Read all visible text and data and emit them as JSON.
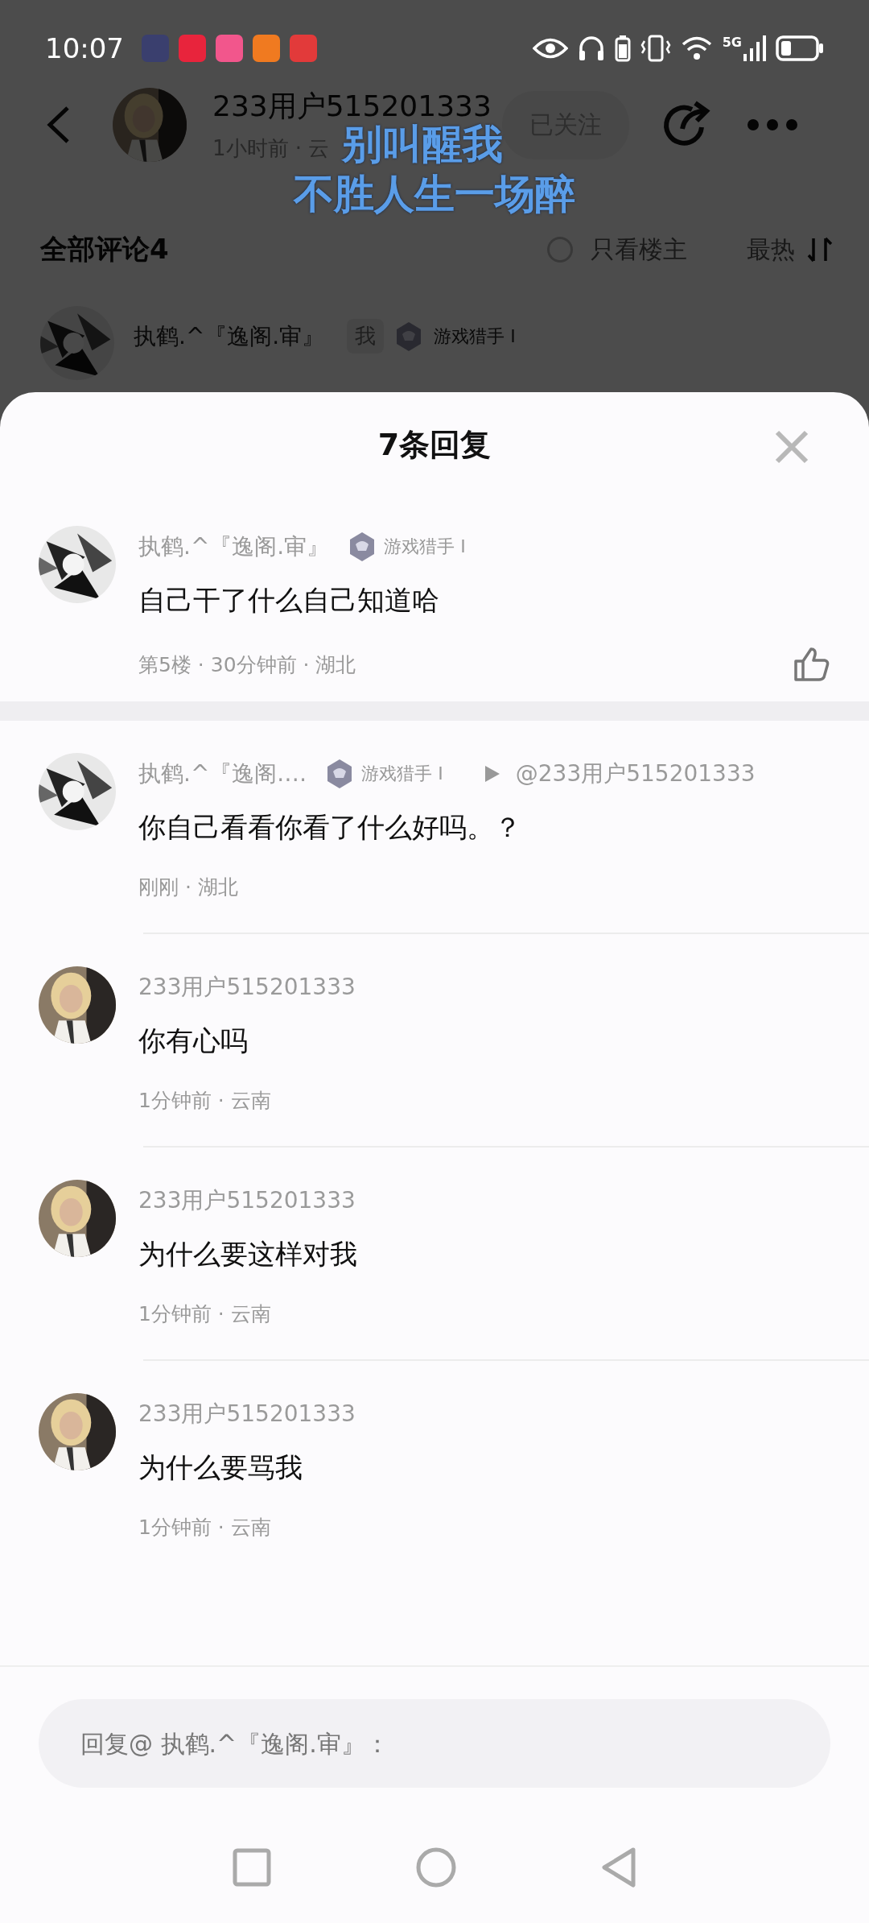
{
  "status_bar": {
    "time": "10:07",
    "notifications": [
      {
        "color": "#3a3f6e"
      },
      {
        "color": "#e8243c"
      },
      {
        "color": "#f2568c"
      },
      {
        "color": "#f07a20"
      },
      {
        "color": "#e23a3a"
      }
    ],
    "network": "5G"
  },
  "post_header": {
    "author": "233用户515201333",
    "meta": "1小时前 · 云",
    "follow_button": "已关注"
  },
  "caption_overlay": [
    "别叫醒我",
    "不胜人生一场醉"
  ],
  "comments_bar": {
    "title": "全部评论4",
    "only_op": {
      "label": "只看楼主",
      "checked": false
    },
    "sort": {
      "label": "最热"
    }
  },
  "background_comment": {
    "author": "执鹤.^『逸阁.审』",
    "badge": "我",
    "level": "游戏猎手 I"
  },
  "sheet": {
    "title": "7条回复",
    "main_comment": {
      "author": "执鹤.^『逸阁.审』",
      "level": "游戏猎手 I",
      "text": "自己干了什么自己知道哈",
      "meta": "第5楼 · 30分钟前 · 湖北",
      "liked": false
    },
    "replies": [
      {
        "kind": "mono",
        "author": "执鹤.^『逸阁.…",
        "level": "游戏猎手 I",
        "reply_to": "@233用户515201333",
        "text": "你自己看看你看了什么好吗。？",
        "meta": "刚刚 · 湖北"
      },
      {
        "kind": "blonde",
        "author": "233用户515201333",
        "text": "你有心吗",
        "meta": "1分钟前 · 云南"
      },
      {
        "kind": "blonde",
        "author": "233用户515201333",
        "text": "为什么要这样对我",
        "meta": "1分钟前 · 云南"
      },
      {
        "kind": "blonde",
        "author": "233用户515201333",
        "text": "为什么要骂我",
        "meta": "1分钟前 · 云南"
      }
    ],
    "input": {
      "placeholder": "回复@ 执鹤.^『逸阁.审』："
    }
  }
}
